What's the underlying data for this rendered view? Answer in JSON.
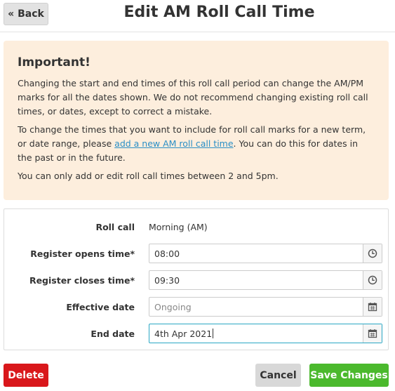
{
  "header": {
    "back_label": "« Back",
    "title": "Edit AM Roll Call Time"
  },
  "notice": {
    "heading": "Important!",
    "p1": "Changing the start and end times of this roll call period can change the AM/PM marks for all the dates shown. We do not recommend changing existing roll call times, or dates, except to correct a mistake.",
    "p2_before": "To change the times that you want to include for roll call marks for a new term, or date range, please ",
    "p2_link": "add a new AM roll call time",
    "p2_after": ". You can do this for dates in the past or in the future.",
    "p3": "You can only add or edit roll call times between 2 and 5pm."
  },
  "form": {
    "roll_call": {
      "label": "Roll call",
      "value": "Morning (AM)"
    },
    "opens": {
      "label": "Register opens time*",
      "value": "08:00",
      "icon": "clock-icon"
    },
    "closes": {
      "label": "Register closes time*",
      "value": "09:30",
      "icon": "clock-icon"
    },
    "effective": {
      "label": "Effective date",
      "placeholder": "Ongoing",
      "icon": "calendar-icon"
    },
    "end": {
      "label": "End date",
      "value": "4th Apr 2021",
      "icon": "calendar-icon"
    }
  },
  "actions": {
    "delete_label": "Delete",
    "cancel_label": "Cancel",
    "save_label": "Save Changes"
  },
  "colors": {
    "notice_bg": "#fdeedd",
    "link": "#2a8fc6",
    "delete": "#d9171b",
    "save": "#4bb92d",
    "focus_border": "#2aa7c4"
  }
}
